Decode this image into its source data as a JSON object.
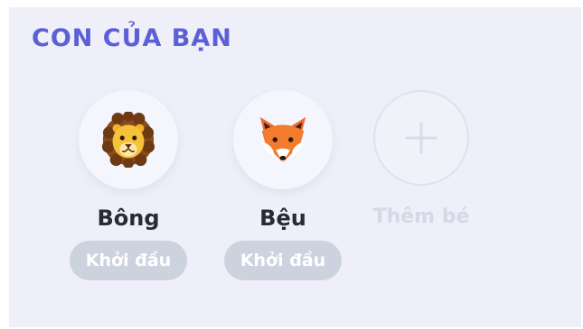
{
  "section": {
    "title": "CON CỦA BẠN"
  },
  "children": [
    {
      "name": "Bông",
      "level": "Khởi đầu",
      "avatar_icon": "lion-icon"
    },
    {
      "name": "Bệu",
      "level": "Khởi đầu",
      "avatar_icon": "fox-icon"
    }
  ],
  "add_child": {
    "label": "Thêm bé",
    "icon": "plus-icon"
  },
  "colors": {
    "panel_bg": "#efeff9",
    "title": "#5b60d6",
    "badge_bg": "#cdd3de",
    "name_text": "#262b36",
    "muted_text": "#d5d8e6"
  }
}
